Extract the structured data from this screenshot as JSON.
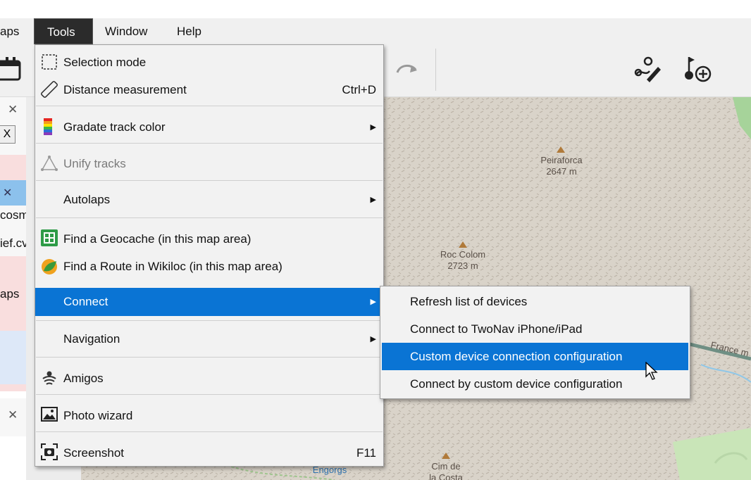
{
  "menubar": {
    "items": [
      {
        "label": "aps"
      },
      {
        "label": "Tools"
      },
      {
        "label": "Window"
      },
      {
        "label": "Help"
      }
    ]
  },
  "side_panel": {
    "close_glyph": "✕",
    "x_button": "X",
    "fragments": [
      "cosm",
      "ief.cv",
      "aps"
    ]
  },
  "tools_menu": {
    "items": [
      {
        "label": "Selection mode",
        "icon": "selection-icon"
      },
      {
        "label": "Distance measurement",
        "shortcut": "Ctrl+D",
        "icon": "ruler-icon"
      },
      {
        "label": "Gradate track color",
        "icon": "color-gradient-icon",
        "submenu": true
      },
      {
        "label": "Unify tracks",
        "icon": "triangle-icon",
        "disabled": true
      },
      {
        "label": "Autolaps",
        "submenu": true
      },
      {
        "label": "Find a Geocache (in this map area)",
        "icon": "geocache-icon"
      },
      {
        "label": "Find a Route in Wikiloc (in this map area)",
        "icon": "wikiloc-icon"
      },
      {
        "label": "Connect",
        "submenu": true,
        "highlighted": true
      },
      {
        "label": "Navigation",
        "submenu": true
      },
      {
        "label": "Amigos",
        "icon": "amigos-icon"
      },
      {
        "label": "Photo wizard",
        "icon": "photo-icon"
      },
      {
        "label": "Screenshot",
        "shortcut": "F11",
        "icon": "screenshot-icon"
      }
    ]
  },
  "connect_submenu": {
    "items": [
      {
        "label": "Refresh list of devices"
      },
      {
        "label": "Connect to TwoNav iPhone/iPad"
      },
      {
        "label": "Custom device connection configuration",
        "highlighted": true
      },
      {
        "label": "Connect by custom device configuration"
      }
    ]
  },
  "map": {
    "labels": [
      {
        "name": "Peiraforca",
        "elev": "2647 m"
      },
      {
        "name": "Roc Colom",
        "elev": "2723 m"
      },
      {
        "name": "Cim de",
        "elev": "la Costa"
      },
      {
        "name": "Engorgs",
        "elev": ""
      },
      {
        "name": "France m",
        "elev": ""
      }
    ]
  },
  "colors": {
    "highlight": "#0a74d4",
    "menu_bg": "#f2f2f2"
  }
}
